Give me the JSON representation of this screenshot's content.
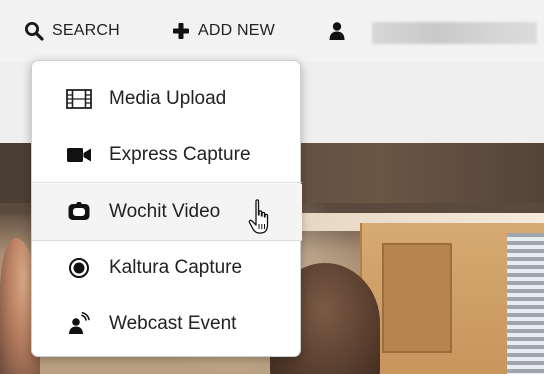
{
  "topbar": {
    "search_label": "SEARCH",
    "add_new_label": "ADD NEW"
  },
  "menu": {
    "items": [
      {
        "label": "Media Upload",
        "icon": "film-icon"
      },
      {
        "label": "Express Capture",
        "icon": "video-camera-icon"
      },
      {
        "label": "Wochit Video",
        "icon": "wochit-icon"
      },
      {
        "label": "Kaltura Capture",
        "icon": "record-icon"
      },
      {
        "label": "Webcast Event",
        "icon": "webcast-icon"
      }
    ],
    "hovered_item": "Wochit Video"
  },
  "colors": {
    "topbar_bg": "#f2f2f2",
    "text": "#222222",
    "menu_bg": "#ffffff",
    "divider": "#dcdcdc"
  }
}
